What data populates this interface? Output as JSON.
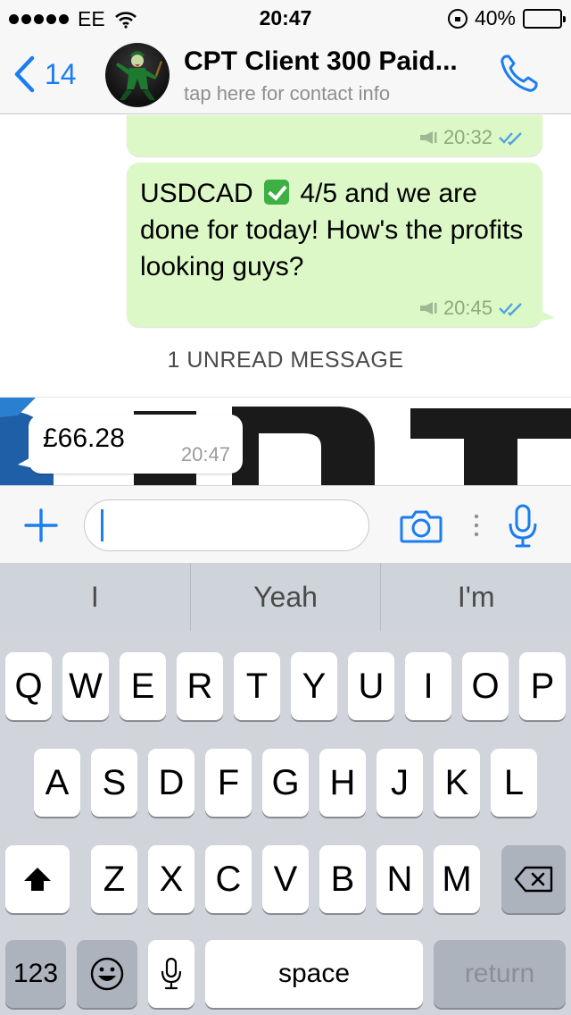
{
  "status_bar": {
    "carrier": "EE",
    "time": "20:47",
    "battery": "40%",
    "battery_level": 0.4,
    "signal_dots": 5
  },
  "header": {
    "back_count": "14",
    "contact_name": "CPT Client 300 Paid...",
    "contact_sub": "tap here for contact info"
  },
  "messages": [
    {
      "direction": "out",
      "text": "",
      "time": "20:32"
    },
    {
      "direction": "out",
      "text_before_emoji": "USDCAD",
      "emoji": "check-mark-emoji",
      "text_after_emoji": " 4/5 and we are done for today! How's the profits looking guys?",
      "time": "20:45"
    },
    {
      "direction": "in",
      "text": "£66.28",
      "time": "20:47"
    }
  ],
  "unread_banner": "1 UNREAD MESSAGE",
  "input": {
    "placeholder": "",
    "value": ""
  },
  "suggestions": [
    "I",
    "Yeah",
    "I'm"
  ],
  "keyboard": {
    "row1": [
      "Q",
      "W",
      "E",
      "R",
      "T",
      "Y",
      "U",
      "I",
      "O",
      "P"
    ],
    "row2": [
      "A",
      "S",
      "D",
      "F",
      "G",
      "H",
      "J",
      "K",
      "L"
    ],
    "row3": [
      "Z",
      "X",
      "C",
      "V",
      "B",
      "N",
      "M"
    ],
    "numbers_label": "123",
    "space_label": "space",
    "return_label": "return"
  },
  "colors": {
    "accent": "#1a7df0",
    "outgoing_bubble": "#dcf8c6",
    "incoming_bubble": "#ffffff",
    "read_ticks": "#4fa3e0"
  }
}
